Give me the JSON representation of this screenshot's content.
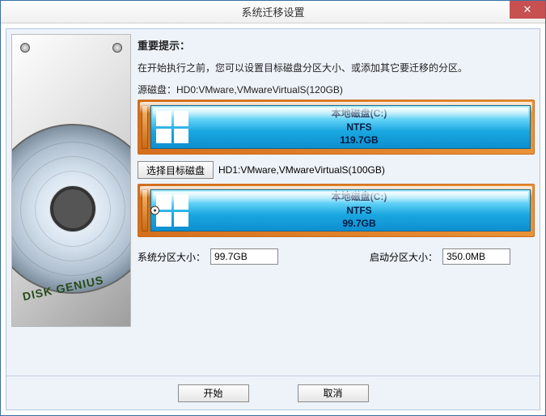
{
  "title": "系统迁移设置",
  "close_glyph": "✕",
  "hint": {
    "title": "重要提示：",
    "text": "在开始执行之前，您可以设置目标磁盘分区大小、或添加其它要迁移的分区。"
  },
  "source": {
    "label": "源磁盘：",
    "value": "HD0:VMware,VMwareVirtualS(120GB)"
  },
  "target_button": "选择目标磁盘",
  "target_disk": "HD1:VMware,VMwareVirtualS(100GB)",
  "partitions": {
    "source": {
      "name": "本地磁盘(C:)",
      "fs": "NTFS",
      "size": "119.7GB"
    },
    "target": {
      "name": "本地磁盘(C:)",
      "fs": "NTFS",
      "size": "99.7GB"
    }
  },
  "fields": {
    "sys_label": "系统分区大小：",
    "sys_value": "99.7GB",
    "boot_label": "启动分区大小：",
    "boot_value": "350.0MB"
  },
  "footer": {
    "start": "开始",
    "cancel": "取消"
  },
  "left_brand": "DISK GENIUS"
}
